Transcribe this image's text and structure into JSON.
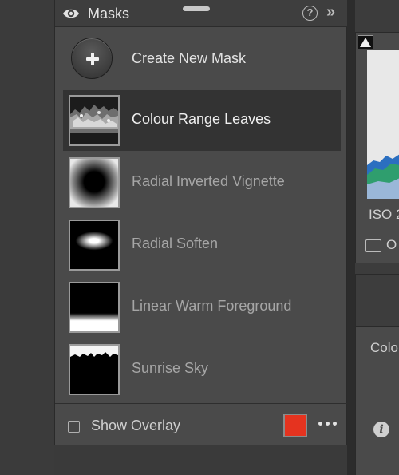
{
  "panel": {
    "title": "Masks",
    "help_glyph": "?",
    "collapse_glyph": "»"
  },
  "create": {
    "label": "Create New Mask"
  },
  "masks": [
    {
      "label": "Colour Range Leaves",
      "selected": true,
      "thumb_icon": "leaves-mask-thumbnail"
    },
    {
      "label": "Radial Inverted Vignette",
      "selected": false,
      "thumb_icon": "inverted-vignette-mask-thumbnail"
    },
    {
      "label": "Radial Soften",
      "selected": false,
      "thumb_icon": "radial-mask-thumbnail"
    },
    {
      "label": "Linear Warm Foreground",
      "selected": false,
      "thumb_icon": "linear-gradient-mask-thumbnail"
    },
    {
      "label": "Sunrise Sky",
      "selected": false,
      "thumb_icon": "sky-mask-thumbnail"
    }
  ],
  "footer": {
    "overlay_label": "Show Overlay",
    "overlay_checked": false,
    "overlay_color": "#e5331f"
  },
  "right_panel": {
    "iso_label": "ISO 2",
    "original_label": "O",
    "properties_title": "Colo",
    "info_glyph": "i"
  },
  "colors": {
    "panel_bg": "#4a4a4a",
    "selected_row_bg": "#333333",
    "app_bg": "#3a3a3a"
  }
}
